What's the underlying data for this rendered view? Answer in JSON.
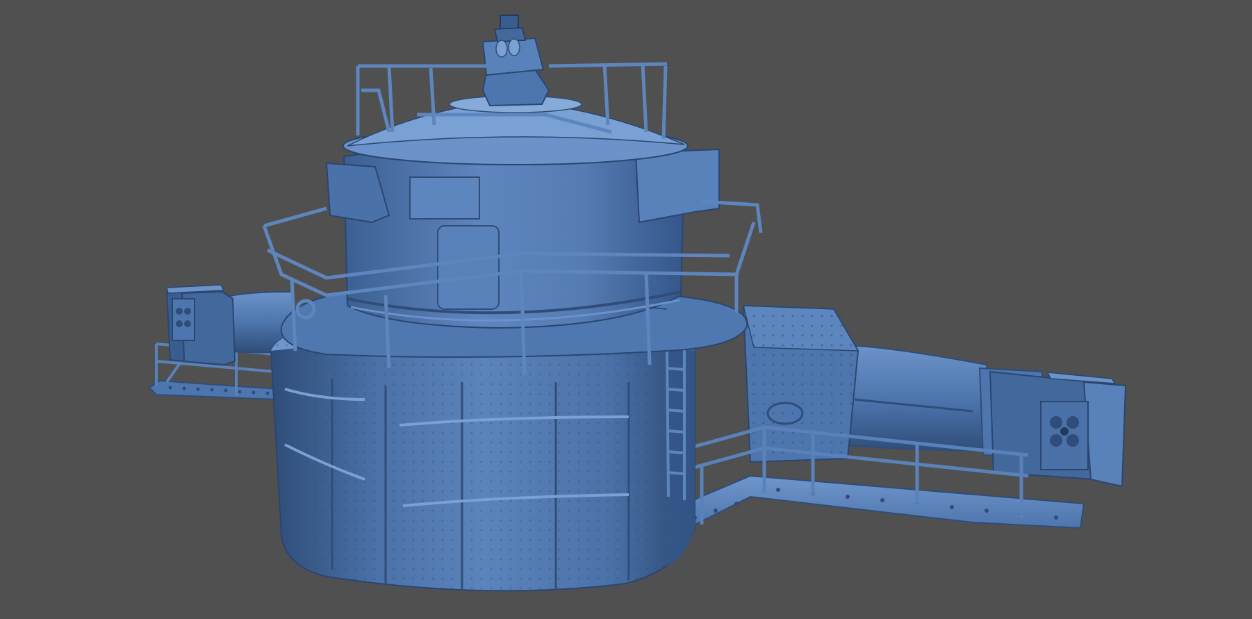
{
  "scene": {
    "subject": "rangefinder-tower-render",
    "colors": {
      "background": "#505050",
      "model_base": "#4e76ae",
      "model_light": "#6b93c9",
      "model_mid": "#43689c",
      "model_dark": "#2f4d78",
      "model_deep": "#223a5c",
      "highlight": "#86abd9"
    }
  }
}
